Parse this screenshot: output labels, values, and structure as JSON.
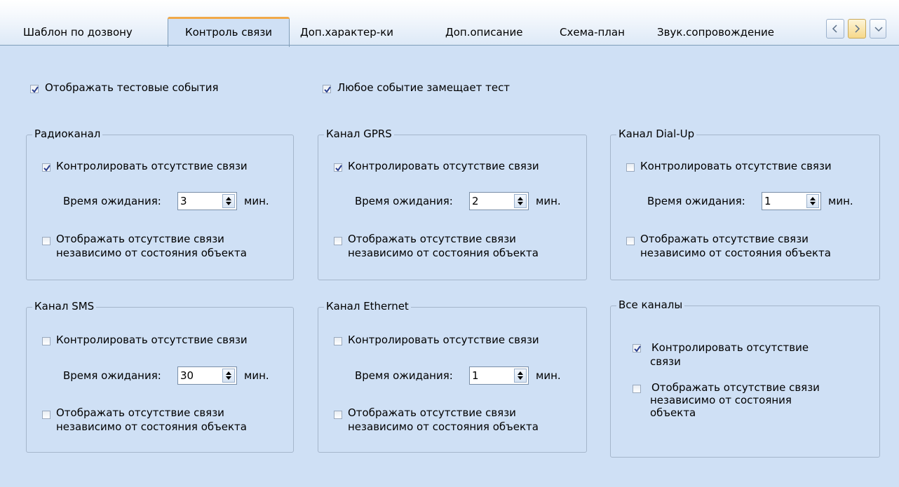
{
  "tabs": [
    {
      "label": "Шаблон по дозвону",
      "active": false
    },
    {
      "label": "Контроль связи",
      "active": true
    },
    {
      "label": "Доп.характер-ки",
      "active": false
    },
    {
      "label": "Доп.описание",
      "active": false
    },
    {
      "label": "Схема-план",
      "active": false
    },
    {
      "label": "Звук.сопровождение",
      "active": false
    }
  ],
  "top_options": {
    "show_test_events": {
      "label": "Отображать тестовые события",
      "checked": true
    },
    "any_event_replaces_test": {
      "label": "Любое событие замещает тест",
      "checked": true
    }
  },
  "groups": [
    {
      "title": "Радиоканал",
      "monitor": {
        "label": "Контролировать отсутствие связи",
        "checked": true
      },
      "wait_label": "Время ожидания:",
      "wait_value": "3",
      "unit": "мин.",
      "show_absence": {
        "line1": "Отображать отсутствие связи",
        "line2": "независимо от состояния объекта",
        "checked": false
      }
    },
    {
      "title": "Канал GPRS",
      "monitor": {
        "label": "Контролировать отсутствие связи",
        "checked": true
      },
      "wait_label": "Время ожидания:",
      "wait_value": "2",
      "unit": "мин.",
      "show_absence": {
        "line1": "Отображать отсутствие связи",
        "line2": "независимо от состояния объекта",
        "checked": false
      }
    },
    {
      "title": "Канал Dial-Up",
      "monitor": {
        "label": "Контролировать отсутствие связи",
        "checked": false
      },
      "wait_label": "Время ожидания:",
      "wait_value": "1",
      "unit": "мин.",
      "show_absence": {
        "line1": "Отображать отсутствие связи",
        "line2": "независимо от состояния объекта",
        "checked": false
      }
    },
    {
      "title": "Канал SMS",
      "monitor": {
        "label": "Контролировать отсутствие связи",
        "checked": false
      },
      "wait_label": "Время ожидания:",
      "wait_value": "30",
      "unit": "мин.",
      "show_absence": {
        "line1": "Отображать отсутствие связи",
        "line2": "независимо от состояния объекта",
        "checked": false
      }
    },
    {
      "title": "Канал Ethernet",
      "monitor": {
        "label": "Контролировать отсутствие связи",
        "checked": false
      },
      "wait_label": "Время ожидания:",
      "wait_value": "1",
      "unit": "мин.",
      "show_absence": {
        "line1": "Отображать отсутствие связи",
        "line2": "независимо от состояния объекта",
        "checked": false
      }
    }
  ],
  "all_channels": {
    "title": "Все каналы",
    "monitor": {
      "line1": "Контролировать отсутствие",
      "line2": "связи",
      "checked": true
    },
    "show_absence": {
      "line1": "Отображать отсутствие связи",
      "line2": "независимо от состояния",
      "line3": "объекта",
      "checked": false
    }
  },
  "colors": {
    "background": "#cfe0f5",
    "active_tab_accent": "#f1a94a",
    "group_border": "#a5b6cb"
  },
  "icons": {
    "scroll_left": "chevron-left-icon",
    "scroll_right": "chevron-right-icon",
    "dropdown": "chevron-down-icon",
    "checkmark": "checkmark-icon"
  }
}
